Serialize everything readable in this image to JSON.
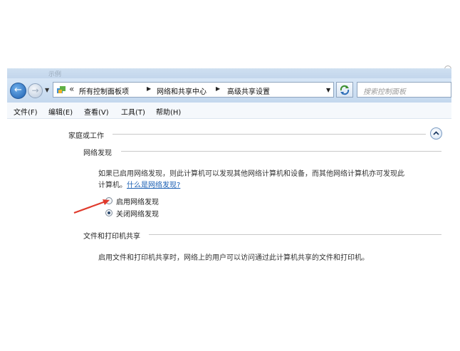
{
  "window": {
    "title": "示例"
  },
  "address_bar": {
    "overflow_marker": "«",
    "breadcrumbs": [
      "所有控制面板项",
      "网络和共享中心",
      "高级共享设置"
    ],
    "search_placeholder": "搜索控制面板"
  },
  "menu": {
    "items": [
      "文件(F)",
      "编辑(E)",
      "查看(V)",
      "工具(T)",
      "帮助(H)"
    ]
  },
  "content": {
    "profile_label": "家庭或工作",
    "network_discovery": {
      "heading": "网络发现",
      "description_line1": "如果已启用网络发现，则此计算机可以发现其他网络计算机和设备，而其他网络计算机亦可发现此",
      "description_line2": "计算机。",
      "help_link": "什么是网络发现?",
      "options": [
        {
          "label": "启用网络发现",
          "selected": false
        },
        {
          "label": "关闭网络发现",
          "selected": true
        }
      ]
    },
    "file_sharing": {
      "heading": "文件和打印机共享",
      "description": "启用文件和打印机共享时，网络上的用户可以访问通过此计算机共享的文件和打印机。"
    }
  },
  "colors": {
    "link": "#1a5fb4",
    "annotation_arrow": "#e03a2c",
    "chrome": "#c9dbef"
  }
}
